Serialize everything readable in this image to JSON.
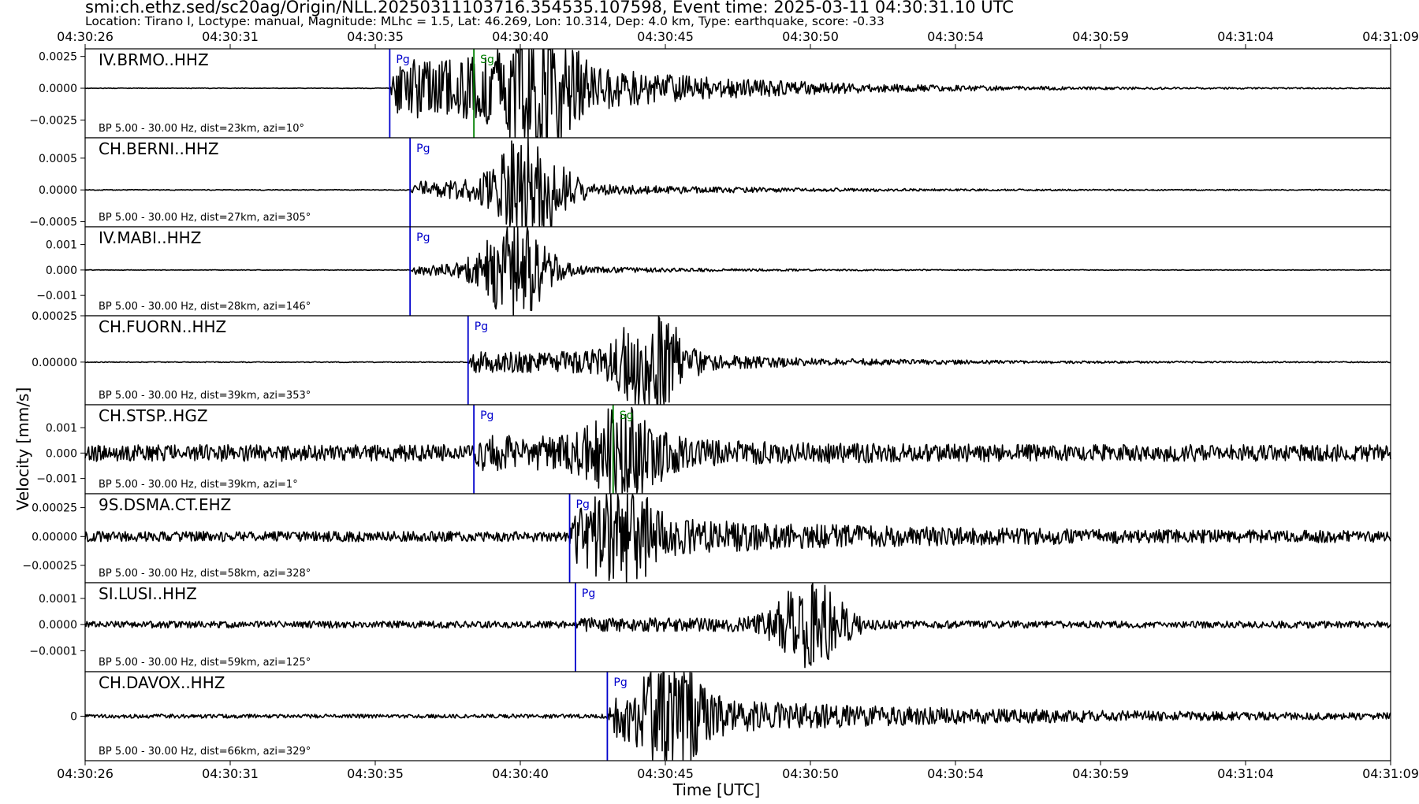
{
  "header": {
    "title": "smi:ch.ethz.sed/sc20ag/Origin/NLL.20250311103716.354535.107598, Event time: 2025-03-11 04:30:31.10 UTC",
    "subtitle": "Location: Tirano I, Loctype: manual, Magnitude: MLhc = 1.5, Lat: 46.269, Lon: 10.314, Dep: 4.0 km, Type: earthquake, score: -0.33"
  },
  "chart_data": {
    "type": "line",
    "title": "smi:ch.ethz.sed/sc20ag/Origin/NLL.20250311103716.354535.107598, Event time: 2025-03-11 04:30:31.10 UTC",
    "xlabel": "Time [UTC]",
    "ylabel": "Velocity [mm/s]",
    "x_ticks": [
      "04:30:26",
      "04:30:31",
      "04:30:35",
      "04:30:40",
      "04:30:45",
      "04:30:50",
      "04:30:54",
      "04:30:59",
      "04:31:04",
      "04:31:09"
    ],
    "xlim_seconds_after_042626": [
      0,
      45
    ],
    "colors": {
      "trace": "#000000",
      "pg": "#0000cc",
      "sg": "#008000"
    },
    "panels": [
      {
        "station": "IV.BRMO..HHZ",
        "filter": "BP 5.00 - 30.00 Hz, dist=23km, azi=10°",
        "y_ticks": [
          "0.0025",
          "0.0000",
          "−0.0025"
        ],
        "y_tick_values": [
          0.0025,
          0.0,
          -0.0025
        ],
        "ylim": [
          -0.0039,
          0.0031
        ],
        "picks": [
          {
            "phase": "Pg",
            "t": 10.5,
            "color": "#0000cc"
          },
          {
            "phase": "Sg",
            "t": 13.4,
            "color": "#008000"
          }
        ],
        "signal": {
          "noise": 2e-05,
          "amp": 0.0021,
          "peak_t": 15.6,
          "peak_amp": 0.0042,
          "decay": 6.0
        }
      },
      {
        "station": "CH.BERNI..HHZ",
        "filter": "BP 5.00 - 30.00 Hz, dist=27km, azi=305°",
        "y_ticks": [
          "0.0005",
          "0.0000",
          "−0.0005"
        ],
        "y_tick_values": [
          0.0005,
          0.0,
          -0.0005
        ],
        "ylim": [
          -0.00058,
          0.00082
        ],
        "picks": [
          {
            "phase": "Pg",
            "t": 11.2,
            "color": "#0000cc"
          }
        ],
        "signal": {
          "noise": 6e-06,
          "amp": 0.00012,
          "peak_t": 15.3,
          "peak_amp": 0.00075,
          "decay": 5.5
        }
      },
      {
        "station": "IV.MABI..HHZ",
        "filter": "BP 5.00 - 30.00 Hz, dist=28km, azi=146°",
        "y_ticks": [
          "0.001",
          "0.000",
          "−0.001"
        ],
        "y_tick_values": [
          0.001,
          0.0,
          -0.001
        ],
        "ylim": [
          -0.0018,
          0.0017
        ],
        "picks": [
          {
            "phase": "Pg",
            "t": 11.2,
            "color": "#0000cc"
          }
        ],
        "signal": {
          "noise": 1e-05,
          "amp": 0.00018,
          "peak_t": 14.8,
          "peak_amp": 0.0017,
          "decay": 5.0
        }
      },
      {
        "station": "CH.FUORN..HHZ",
        "filter": "BP 5.00 - 30.00 Hz, dist=39km, azi=353°",
        "y_ticks": [
          "0.00025",
          "0.00000"
        ],
        "y_tick_values": [
          0.00025,
          0.0
        ],
        "ylim": [
          -0.00023,
          0.00025
        ],
        "picks": [
          {
            "phase": "Pg",
            "t": 13.2,
            "color": "#0000cc"
          }
        ],
        "signal": {
          "noise": 2e-06,
          "amp": 5e-05,
          "peak_t": 19.5,
          "peak_amp": 0.00022,
          "decay": 6.0
        }
      },
      {
        "station": "CH.STSP..HGZ",
        "filter": "BP 5.00 - 30.00 Hz, dist=39km, azi=1°",
        "y_ticks": [
          "0.001",
          "0.000",
          "−0.001"
        ],
        "y_tick_values": [
          0.001,
          0.0,
          -0.001
        ],
        "ylim": [
          -0.0016,
          0.0019
        ],
        "picks": [
          {
            "phase": "Pg",
            "t": 13.4,
            "color": "#0000cc"
          },
          {
            "phase": "Sg",
            "t": 18.2,
            "color": "#008000"
          }
        ],
        "signal": {
          "noise": 0.0003,
          "amp": 0.00035,
          "peak_t": 18.7,
          "peak_amp": 0.0013,
          "decay": 4.0
        }
      },
      {
        "station": "9S.DSMA.CT.EHZ",
        "filter": "BP 5.00 - 30.00 Hz, dist=58km, azi=328°",
        "y_ticks": [
          "0.00025",
          "0.00000",
          "−0.00025"
        ],
        "y_tick_values": [
          0.00025,
          0.0,
          -0.00025
        ],
        "ylim": [
          -0.0004,
          0.00037
        ],
        "picks": [
          {
            "phase": "Pg",
            "t": 16.7,
            "color": "#0000cc"
          }
        ],
        "signal": {
          "noise": 4e-05,
          "amp": 0.00012,
          "peak_t": 18.5,
          "peak_amp": 0.00028,
          "decay": 9.0
        }
      },
      {
        "station": "SI.LUSI..HHZ",
        "filter": "BP 5.00 - 30.00 Hz, dist=59km, azi=125°",
        "y_ticks": [
          "0.0001",
          "0.0000",
          "−0.0001"
        ],
        "y_tick_values": [
          0.0001,
          0.0,
          -0.0001
        ],
        "ylim": [
          -0.00018,
          0.00016
        ],
        "picks": [
          {
            "phase": "Pg",
            "t": 16.9,
            "color": "#0000cc"
          }
        ],
        "signal": {
          "noise": 1.2e-05,
          "amp": 1.2e-05,
          "peak_t": 25.0,
          "peak_amp": 0.00014,
          "decay": 2.0
        }
      },
      {
        "station": "CH.DAVOX..HHZ",
        "filter": "BP 5.00 - 30.00 Hz, dist=66km, azi=329°",
        "y_ticks": [
          "0"
        ],
        "y_tick_values": [
          0
        ],
        "ylim": [
          -1.0,
          1.0
        ],
        "picks": [
          {
            "phase": "Pg",
            "t": 18.0,
            "color": "#0000cc"
          }
        ],
        "signal": {
          "noise": 0.04,
          "amp": 0.35,
          "peak_t": 20.2,
          "peak_amp": 0.8,
          "decay": 10.0
        }
      }
    ]
  }
}
